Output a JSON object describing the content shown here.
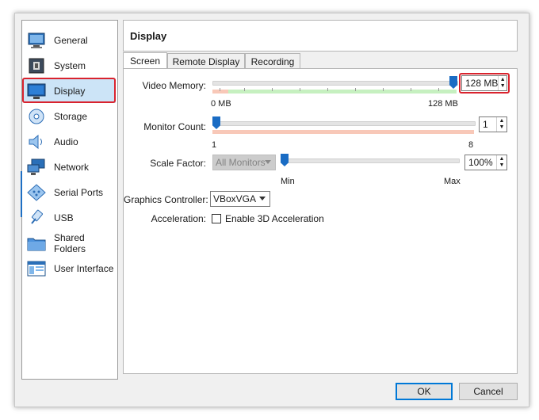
{
  "sidebar": {
    "items": [
      {
        "label": "General",
        "icon": "monitor-icon"
      },
      {
        "label": "System",
        "icon": "chip-icon"
      },
      {
        "label": "Display",
        "icon": "display-icon"
      },
      {
        "label": "Storage",
        "icon": "disk-icon"
      },
      {
        "label": "Audio",
        "icon": "speaker-icon"
      },
      {
        "label": "Network",
        "icon": "network-icon"
      },
      {
        "label": "Serial Ports",
        "icon": "serial-icon"
      },
      {
        "label": "USB",
        "icon": "usb-icon"
      },
      {
        "label": "Shared Folders",
        "icon": "folder-icon"
      },
      {
        "label": "User Interface",
        "icon": "ui-icon"
      }
    ],
    "selected": "Display"
  },
  "header": {
    "title": "Display"
  },
  "tabs": [
    {
      "label": "Screen",
      "active": true
    },
    {
      "label": "Remote Display",
      "active": false
    },
    {
      "label": "Recording",
      "active": false
    }
  ],
  "video_memory": {
    "label": "Video Memory:",
    "value": "128 MB",
    "min_label": "0 MB",
    "max_label": "128 MB",
    "level": 1.0
  },
  "monitor_count": {
    "label": "Monitor Count:",
    "value": "1",
    "min_label": "1",
    "max_label": "8",
    "level": 0.0
  },
  "scale_factor": {
    "label": "Scale Factor:",
    "monitor_select": "All Monitors",
    "value": "100%",
    "min_label": "Min",
    "max_label": "Max",
    "level": 0.0
  },
  "graphics_controller": {
    "label": "Graphics Controller:",
    "value": "VBoxVGA"
  },
  "acceleration": {
    "label": "Acceleration:",
    "checkbox_label": "Enable 3D Acceleration",
    "checked": false
  },
  "buttons": {
    "ok": "OK",
    "cancel": "Cancel"
  },
  "colors": {
    "accent": "#1a6cc4",
    "highlight": "#d9232e",
    "selection": "#cce4f7",
    "zone_green": "#c6f0c0",
    "zone_red": "#f8c8b8"
  }
}
